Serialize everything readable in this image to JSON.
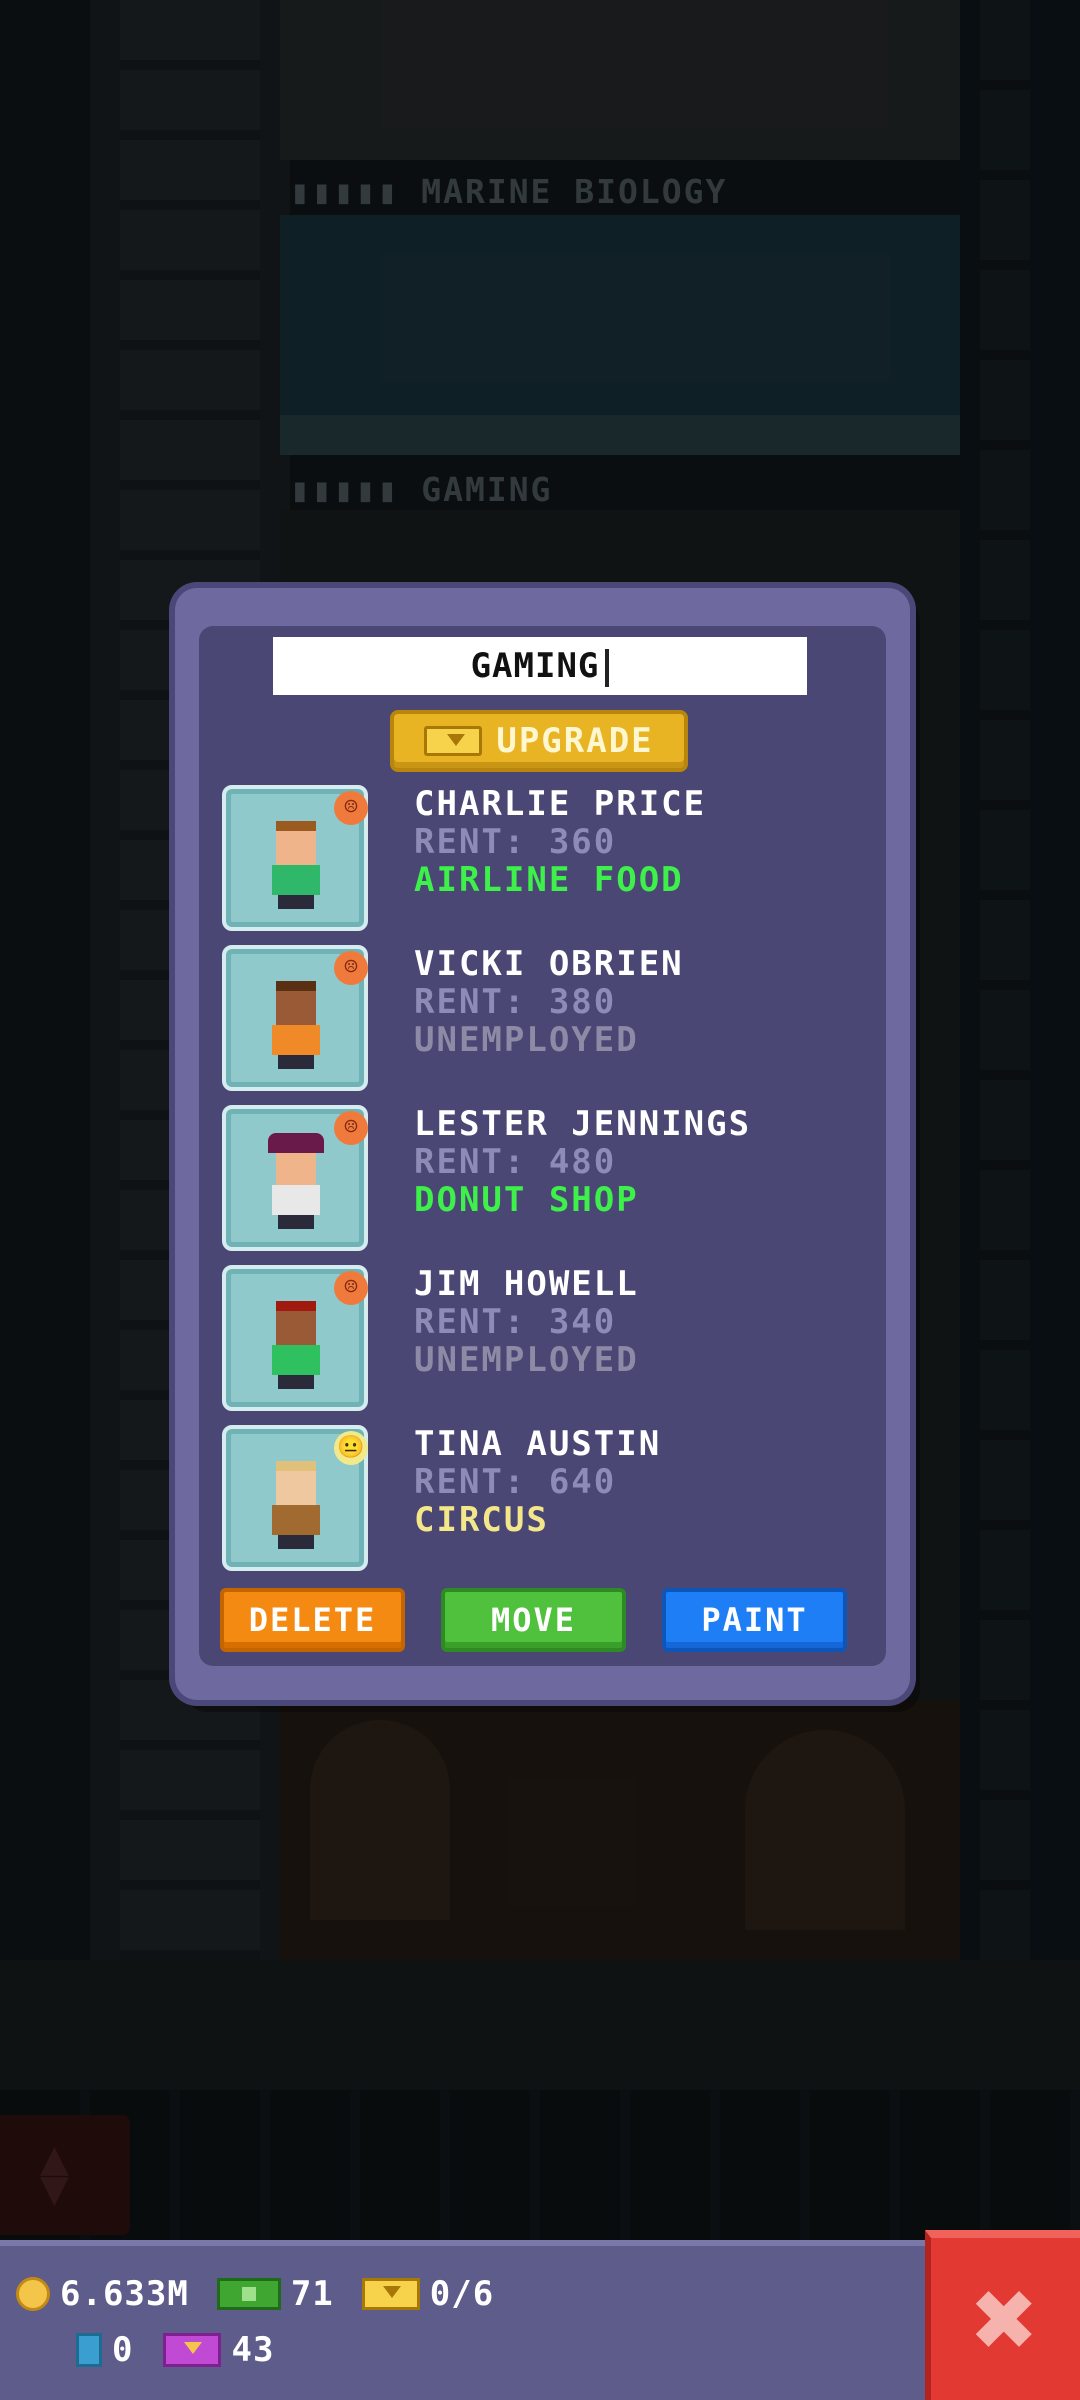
{
  "background": {
    "floor_labels": [
      "MARINE BIOLOGY",
      "GAMING"
    ],
    "floor_label_icon": "people-icon"
  },
  "dialog": {
    "name_value": "GAMING",
    "upgrade_label": "UPGRADE",
    "residents": [
      {
        "name": "CHARLIE PRICE",
        "rent": "RENT: 360",
        "job": "AIRLINE FOOD",
        "job_style": "job-green",
        "mood": "sad",
        "mood_icon": "sad-face-icon",
        "skin": "#f0b48a",
        "hair": "#9a5a20",
        "shirt": "#2fb86a",
        "hat": ""
      },
      {
        "name": "VICKI OBRIEN",
        "rent": "RENT: 380",
        "job": "UNEMPLOYED",
        "job_style": "job-gray",
        "mood": "sad",
        "mood_icon": "sad-face-icon",
        "skin": "#9a5a35",
        "hair": "#5a3015",
        "shirt": "#f08a28",
        "hat": ""
      },
      {
        "name": "LESTER JENNINGS",
        "rent": "RENT: 480",
        "job": "DONUT SHOP",
        "job_style": "job-green",
        "mood": "sad",
        "mood_icon": "sad-face-icon",
        "skin": "#f0b48a",
        "hair": "#ffffff",
        "shirt": "#e8e8e8",
        "hat": "#6a1a4a"
      },
      {
        "name": "JIM HOWELL",
        "rent": "RENT: 340",
        "job": "UNEMPLOYED",
        "job_style": "job-gray",
        "mood": "sad",
        "mood_icon": "sad-face-icon",
        "skin": "#9a5a35",
        "hair": "#a01a10",
        "shirt": "#2fc060",
        "hat": ""
      },
      {
        "name": "TINA AUSTIN",
        "rent": "RENT: 640",
        "job": "CIRCUS",
        "job_style": "job-yellow",
        "mood": "neutral",
        "mood_icon": "neutral-face-icon",
        "skin": "#f0c8a0",
        "hair": "#e0c07a",
        "shirt": "#a06a30",
        "hat": ""
      }
    ],
    "buttons": {
      "delete": "DELETE",
      "move": "MOVE",
      "paint": "PAINT"
    }
  },
  "hud": {
    "coins": "6.633M",
    "bux": "71",
    "gold_bux": "0/6",
    "keys": "0",
    "tickets": "43"
  }
}
